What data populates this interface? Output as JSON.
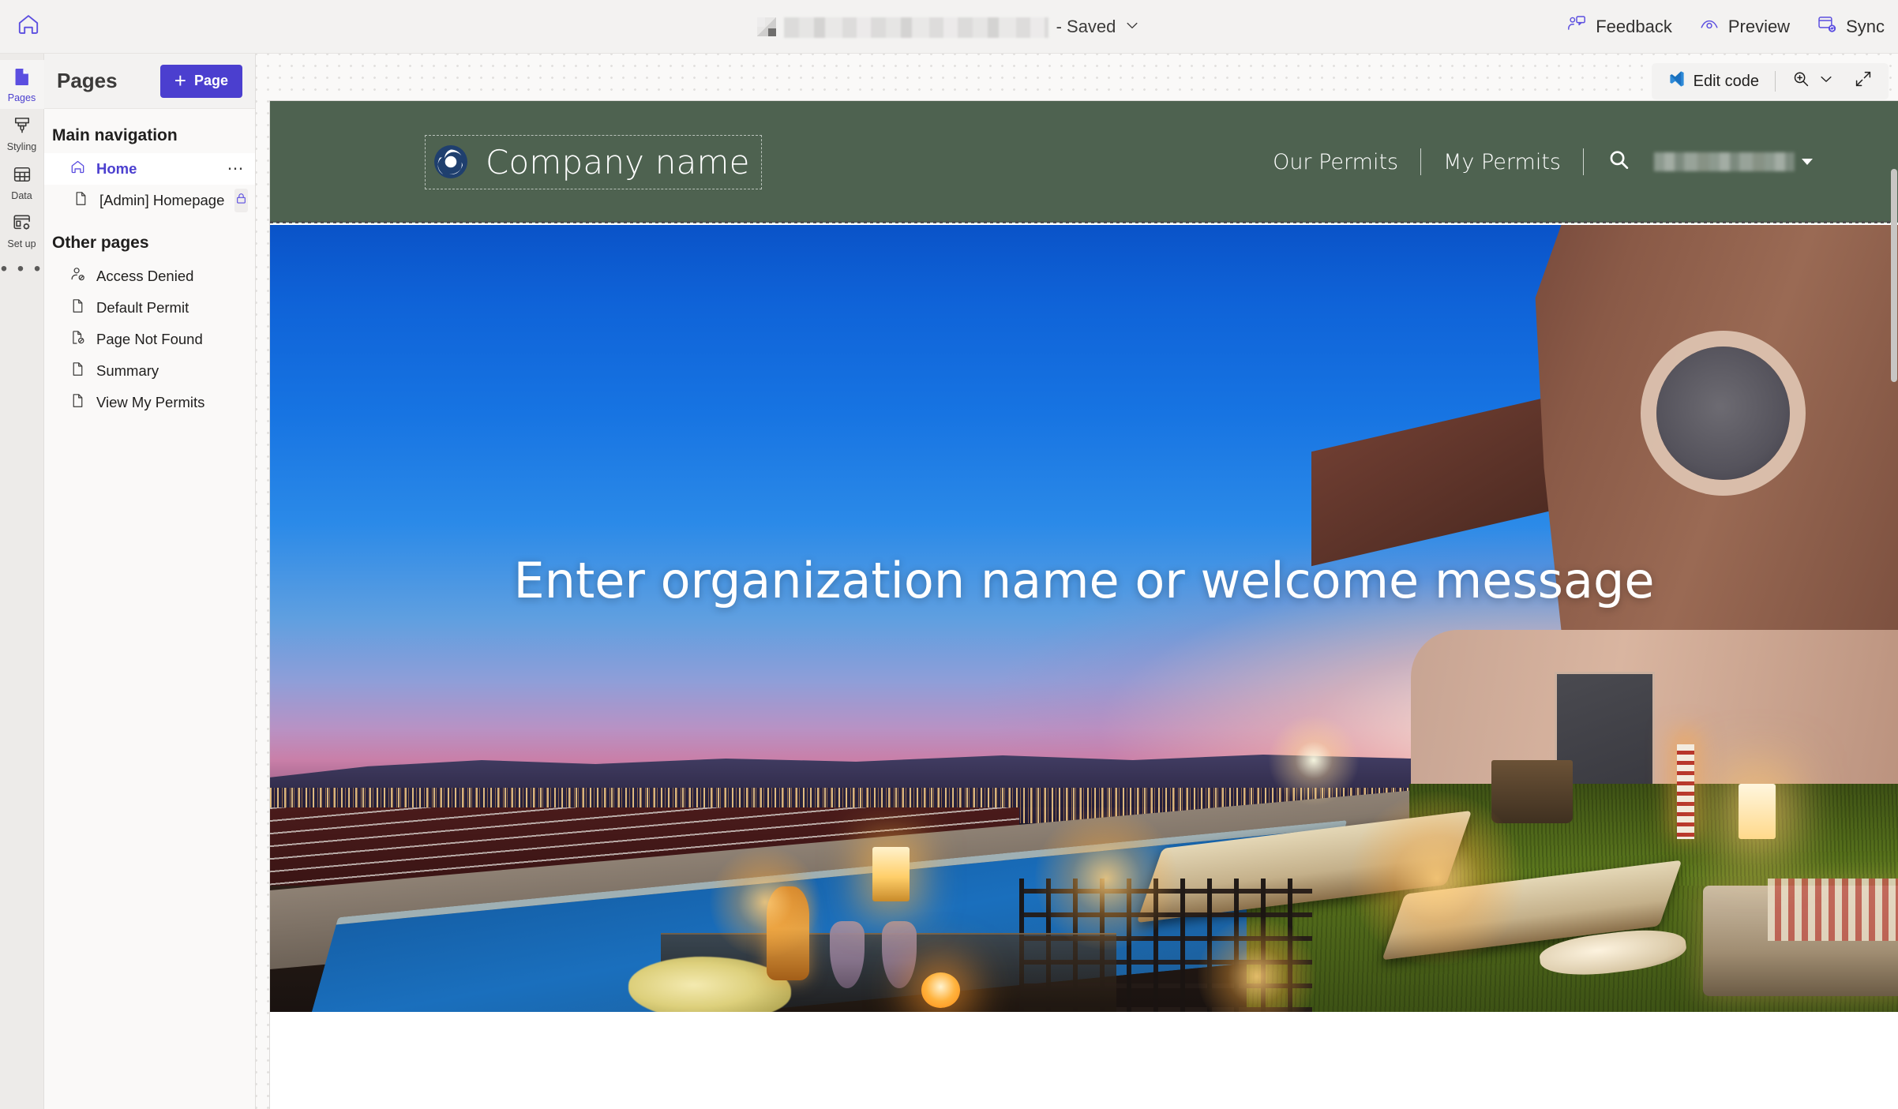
{
  "topbar": {
    "home_icon": "home-icon",
    "title_redacted": true,
    "title_suffix": "- Saved",
    "chevron_icon": "chevron-down-icon",
    "actions": [
      {
        "label": "Feedback",
        "icon": "feedback-icon"
      },
      {
        "label": "Preview",
        "icon": "eye-preview-icon"
      },
      {
        "label": "Sync",
        "icon": "sync-icon"
      }
    ]
  },
  "rail": {
    "items": [
      {
        "label": "Pages",
        "icon": "page-file-icon",
        "active": true
      },
      {
        "label": "Styling",
        "icon": "paint-brush-icon",
        "active": false
      },
      {
        "label": "Data",
        "icon": "table-grid-icon",
        "active": false
      },
      {
        "label": "Set up",
        "icon": "setup-gear-icon",
        "active": false
      }
    ],
    "more_label": "• • •"
  },
  "pages_panel": {
    "title": "Pages",
    "add_button": {
      "label": "Page",
      "plus": "+"
    },
    "main_nav_label": "Main navigation",
    "main_nav_items": [
      {
        "label": "Home",
        "icon": "home-outline-icon",
        "selected": true,
        "trailing": "ellipsis"
      },
      {
        "label": "[Admin] Homepage",
        "icon": "file-icon",
        "selected": false,
        "trailing": "lock"
      }
    ],
    "other_pages_label": "Other pages",
    "other_pages_items": [
      {
        "label": "Access Denied",
        "icon": "person-blocked-icon"
      },
      {
        "label": "Default Permit",
        "icon": "file-icon"
      },
      {
        "label": "Page Not Found",
        "icon": "file-blocked-icon"
      },
      {
        "label": "Summary",
        "icon": "file-icon"
      },
      {
        "label": "View My Permits",
        "icon": "file-icon"
      }
    ]
  },
  "canvas_toolbar": {
    "edit_code_label": "Edit code",
    "edit_code_icon": "vscode-icon",
    "zoom_icon": "zoom-in-icon",
    "zoom_chevron_icon": "chevron-down-icon",
    "expand_icon": "expand-diagonal-icon"
  },
  "preview": {
    "header_bg": "#4e6250",
    "brand": {
      "name": "Company name",
      "logo_icon": "circle-swirl-logo-icon"
    },
    "nav_links": [
      "Our Permits",
      "My Permits"
    ],
    "search_icon": "search-icon",
    "user_name_redacted": true,
    "user_caret_icon": "caret-down-icon",
    "hero": {
      "title": "Enter organization name or welcome message",
      "image_alt": "Poolside terrace at dusk with city and sea view"
    }
  },
  "colors": {
    "accent_purple": "#4b3fcf",
    "site_header_green": "#4e6250",
    "canvas_bg": "#faf9f8",
    "rail_bg": "#edebe9",
    "panel_bg": "#faf9f8"
  }
}
